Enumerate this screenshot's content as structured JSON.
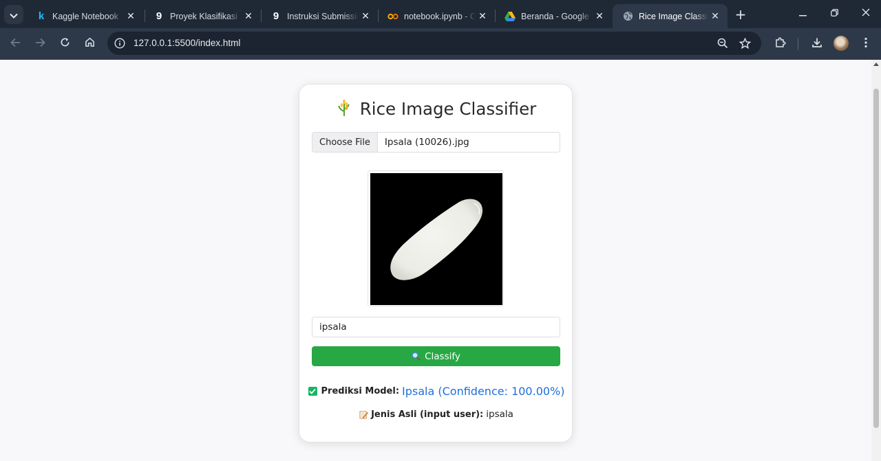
{
  "browser": {
    "tabs": [
      {
        "title": "Kaggle Notebook",
        "icon": "kaggle-icon",
        "active": false
      },
      {
        "title": "Proyek Klasifikasi",
        "icon": "dicoding-icon",
        "active": false
      },
      {
        "title": "Instruksi Submission",
        "icon": "dicoding-icon",
        "active": false
      },
      {
        "title": "notebook.ipynb - Colab",
        "icon": "colab-icon",
        "active": false
      },
      {
        "title": "Beranda - Google Drive",
        "icon": "drive-icon",
        "active": false
      },
      {
        "title": "Rice Image Classifier",
        "icon": "globe-icon",
        "active": true
      }
    ],
    "url": "127.0.0.1:5500/index.html"
  },
  "app": {
    "title": "Rice Image Classifier",
    "title_icon": "rice-plant-icon",
    "file_input": {
      "button_label": "Choose File",
      "file_name": "Ipsala (10026).jpg"
    },
    "preview_alt": "rice grain preview",
    "variety_input": {
      "value": "ipsala"
    },
    "classify_button": {
      "label": "Classify",
      "icon": "magnifier-icon"
    },
    "prediction": {
      "label": "Prediksi Model:",
      "value": "Ipsala (Confidence: 100.00%)"
    },
    "ground_truth": {
      "label": "Jenis Asli (input user):",
      "value": "ipsala"
    }
  },
  "colors": {
    "classify_button": "#27a844",
    "prediction_text": "#1d6fd8",
    "check": "#16b566",
    "tabstrip": "#1f2835",
    "toolbar": "#2d3949"
  }
}
